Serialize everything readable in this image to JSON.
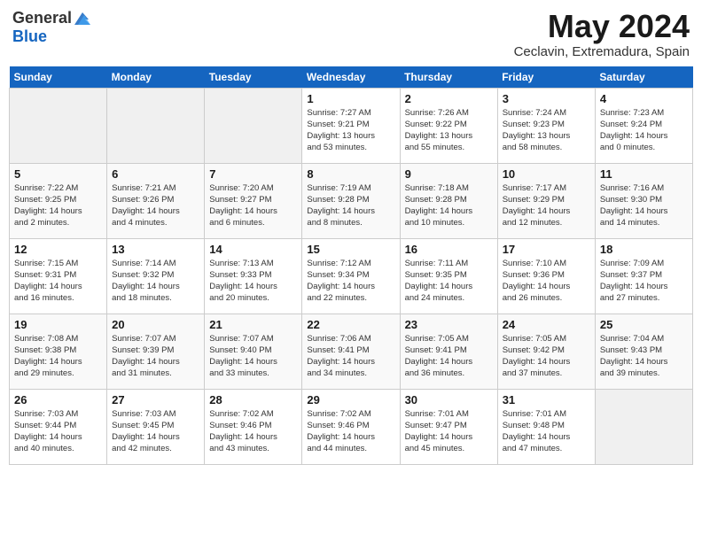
{
  "header": {
    "logo_general": "General",
    "logo_blue": "Blue",
    "month_title": "May 2024",
    "location": "Ceclavin, Extremadura, Spain"
  },
  "weekdays": [
    "Sunday",
    "Monday",
    "Tuesday",
    "Wednesday",
    "Thursday",
    "Friday",
    "Saturday"
  ],
  "weeks": [
    [
      {
        "day": "",
        "info": ""
      },
      {
        "day": "",
        "info": ""
      },
      {
        "day": "",
        "info": ""
      },
      {
        "day": "1",
        "info": "Sunrise: 7:27 AM\nSunset: 9:21 PM\nDaylight: 13 hours\nand 53 minutes."
      },
      {
        "day": "2",
        "info": "Sunrise: 7:26 AM\nSunset: 9:22 PM\nDaylight: 13 hours\nand 55 minutes."
      },
      {
        "day": "3",
        "info": "Sunrise: 7:24 AM\nSunset: 9:23 PM\nDaylight: 13 hours\nand 58 minutes."
      },
      {
        "day": "4",
        "info": "Sunrise: 7:23 AM\nSunset: 9:24 PM\nDaylight: 14 hours\nand 0 minutes."
      }
    ],
    [
      {
        "day": "5",
        "info": "Sunrise: 7:22 AM\nSunset: 9:25 PM\nDaylight: 14 hours\nand 2 minutes."
      },
      {
        "day": "6",
        "info": "Sunrise: 7:21 AM\nSunset: 9:26 PM\nDaylight: 14 hours\nand 4 minutes."
      },
      {
        "day": "7",
        "info": "Sunrise: 7:20 AM\nSunset: 9:27 PM\nDaylight: 14 hours\nand 6 minutes."
      },
      {
        "day": "8",
        "info": "Sunrise: 7:19 AM\nSunset: 9:28 PM\nDaylight: 14 hours\nand 8 minutes."
      },
      {
        "day": "9",
        "info": "Sunrise: 7:18 AM\nSunset: 9:28 PM\nDaylight: 14 hours\nand 10 minutes."
      },
      {
        "day": "10",
        "info": "Sunrise: 7:17 AM\nSunset: 9:29 PM\nDaylight: 14 hours\nand 12 minutes."
      },
      {
        "day": "11",
        "info": "Sunrise: 7:16 AM\nSunset: 9:30 PM\nDaylight: 14 hours\nand 14 minutes."
      }
    ],
    [
      {
        "day": "12",
        "info": "Sunrise: 7:15 AM\nSunset: 9:31 PM\nDaylight: 14 hours\nand 16 minutes."
      },
      {
        "day": "13",
        "info": "Sunrise: 7:14 AM\nSunset: 9:32 PM\nDaylight: 14 hours\nand 18 minutes."
      },
      {
        "day": "14",
        "info": "Sunrise: 7:13 AM\nSunset: 9:33 PM\nDaylight: 14 hours\nand 20 minutes."
      },
      {
        "day": "15",
        "info": "Sunrise: 7:12 AM\nSunset: 9:34 PM\nDaylight: 14 hours\nand 22 minutes."
      },
      {
        "day": "16",
        "info": "Sunrise: 7:11 AM\nSunset: 9:35 PM\nDaylight: 14 hours\nand 24 minutes."
      },
      {
        "day": "17",
        "info": "Sunrise: 7:10 AM\nSunset: 9:36 PM\nDaylight: 14 hours\nand 26 minutes."
      },
      {
        "day": "18",
        "info": "Sunrise: 7:09 AM\nSunset: 9:37 PM\nDaylight: 14 hours\nand 27 minutes."
      }
    ],
    [
      {
        "day": "19",
        "info": "Sunrise: 7:08 AM\nSunset: 9:38 PM\nDaylight: 14 hours\nand 29 minutes."
      },
      {
        "day": "20",
        "info": "Sunrise: 7:07 AM\nSunset: 9:39 PM\nDaylight: 14 hours\nand 31 minutes."
      },
      {
        "day": "21",
        "info": "Sunrise: 7:07 AM\nSunset: 9:40 PM\nDaylight: 14 hours\nand 33 minutes."
      },
      {
        "day": "22",
        "info": "Sunrise: 7:06 AM\nSunset: 9:41 PM\nDaylight: 14 hours\nand 34 minutes."
      },
      {
        "day": "23",
        "info": "Sunrise: 7:05 AM\nSunset: 9:41 PM\nDaylight: 14 hours\nand 36 minutes."
      },
      {
        "day": "24",
        "info": "Sunrise: 7:05 AM\nSunset: 9:42 PM\nDaylight: 14 hours\nand 37 minutes."
      },
      {
        "day": "25",
        "info": "Sunrise: 7:04 AM\nSunset: 9:43 PM\nDaylight: 14 hours\nand 39 minutes."
      }
    ],
    [
      {
        "day": "26",
        "info": "Sunrise: 7:03 AM\nSunset: 9:44 PM\nDaylight: 14 hours\nand 40 minutes."
      },
      {
        "day": "27",
        "info": "Sunrise: 7:03 AM\nSunset: 9:45 PM\nDaylight: 14 hours\nand 42 minutes."
      },
      {
        "day": "28",
        "info": "Sunrise: 7:02 AM\nSunset: 9:46 PM\nDaylight: 14 hours\nand 43 minutes."
      },
      {
        "day": "29",
        "info": "Sunrise: 7:02 AM\nSunset: 9:46 PM\nDaylight: 14 hours\nand 44 minutes."
      },
      {
        "day": "30",
        "info": "Sunrise: 7:01 AM\nSunset: 9:47 PM\nDaylight: 14 hours\nand 45 minutes."
      },
      {
        "day": "31",
        "info": "Sunrise: 7:01 AM\nSunset: 9:48 PM\nDaylight: 14 hours\nand 47 minutes."
      },
      {
        "day": "",
        "info": ""
      }
    ]
  ]
}
